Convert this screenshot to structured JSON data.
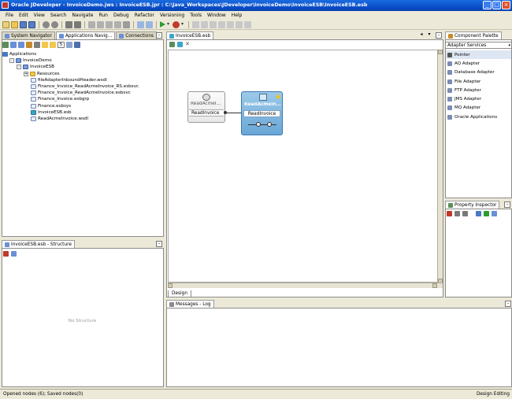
{
  "window": {
    "title": "Oracle JDeveloper - InvoiceDemo.jws : InvoiceESB.jpr : C:\\Java_Workspaces\\JDeveloper\\InvoiceDemo\\InvoiceESB\\InvoiceESB.esb",
    "minimize": "_",
    "maximize": "□",
    "close": "×"
  },
  "menu": [
    "File",
    "Edit",
    "View",
    "Search",
    "Navigate",
    "Run",
    "Debug",
    "Refactor",
    "Versioning",
    "Tools",
    "Window",
    "Help"
  ],
  "navigator": {
    "tabs": [
      "System Navigator",
      "Applications Navig...",
      "Connections"
    ],
    "stepper_value": "5",
    "tree": [
      {
        "label": "Applications",
        "indent": 0,
        "icon": "app",
        "expander": ""
      },
      {
        "label": "InvoiceDemo",
        "indent": 1,
        "icon": "proj",
        "expander": "-"
      },
      {
        "label": "InvoiceESB",
        "indent": 2,
        "icon": "proj",
        "expander": "-"
      },
      {
        "label": "Resources",
        "indent": 3,
        "icon": "folder",
        "expander": "+"
      },
      {
        "label": "fileAdapterInboundHeader.wsdl",
        "indent": 4,
        "icon": "file",
        "expander": ""
      },
      {
        "label": "Finance_Invoice_ReadAcmeInvoice_RS.esbsvc",
        "indent": 4,
        "icon": "file",
        "expander": ""
      },
      {
        "label": "Finance_Invoice_ReadAcmeInvoice.esbsvc",
        "indent": 4,
        "icon": "file",
        "expander": ""
      },
      {
        "label": "Finance_Invoice.esbgrp",
        "indent": 4,
        "icon": "file",
        "expander": ""
      },
      {
        "label": "Finance.esbsys",
        "indent": 4,
        "icon": "file",
        "expander": ""
      },
      {
        "label": "InvoiceESB.esb",
        "indent": 4,
        "icon": "esb",
        "expander": ""
      },
      {
        "label": "ReadAcmeInvoice.wsdl",
        "indent": 4,
        "icon": "file",
        "expander": ""
      }
    ]
  },
  "structure": {
    "tab": "InvoiceESB.esb - Structure",
    "empty_text": "No Structure"
  },
  "editor": {
    "tab": "InvoiceESB.esb",
    "design_tab": "Design",
    "node_adapter": {
      "title": "ReadAcmeI...",
      "operation": "ReadInvoice"
    },
    "node_service": {
      "title": "ReadAcmeInv...",
      "operation": "ReadInvoice"
    }
  },
  "palette": {
    "tab": "Component Palette",
    "selected": "Adapter Services",
    "items": [
      "Pointer",
      "AQ Adapter",
      "Database Adapter",
      "File Adapter",
      "FTP Adapter",
      "JMS Adapter",
      "MQ Adapter",
      "Oracle Applications"
    ]
  },
  "property_inspector": {
    "tab": "Property Inspector"
  },
  "messages": {
    "tab": "Messages - Log"
  },
  "status": {
    "left": "Opened nodes (6); Saved nodes(0)",
    "right": "Design Editing"
  }
}
